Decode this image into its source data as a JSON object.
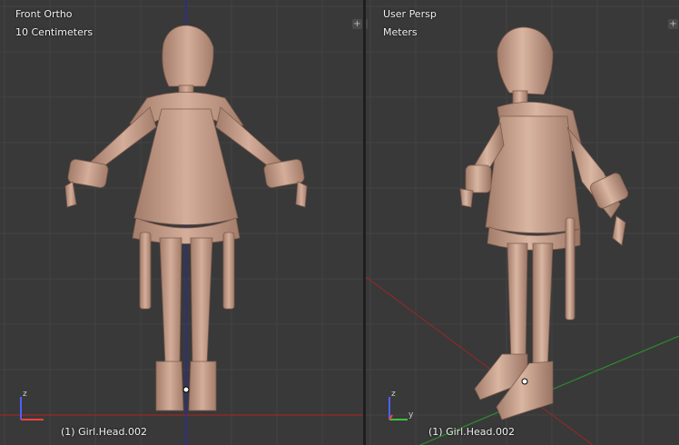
{
  "viewports": {
    "left": {
      "view_name": "Front Ortho",
      "unit_scale": "10 Centimeters",
      "active_object": "(1) Girl.Head.002",
      "gizmo_axes": [
        "z",
        "x"
      ]
    },
    "right": {
      "view_name": "User Persp",
      "unit_scale": "Meters",
      "active_object": "(1) Girl.Head.002",
      "gizmo_axes": [
        "z",
        "y"
      ]
    }
  },
  "colors": {
    "viewport_bg": "#393939",
    "grid_line": "#444444",
    "x_axis": "#8a2a2a",
    "y_axis": "#2e8a2e",
    "z_axis": "#2a2a9a",
    "model_skin": "#cfa995"
  },
  "icons": {
    "corner_widget": "plus-icon"
  }
}
